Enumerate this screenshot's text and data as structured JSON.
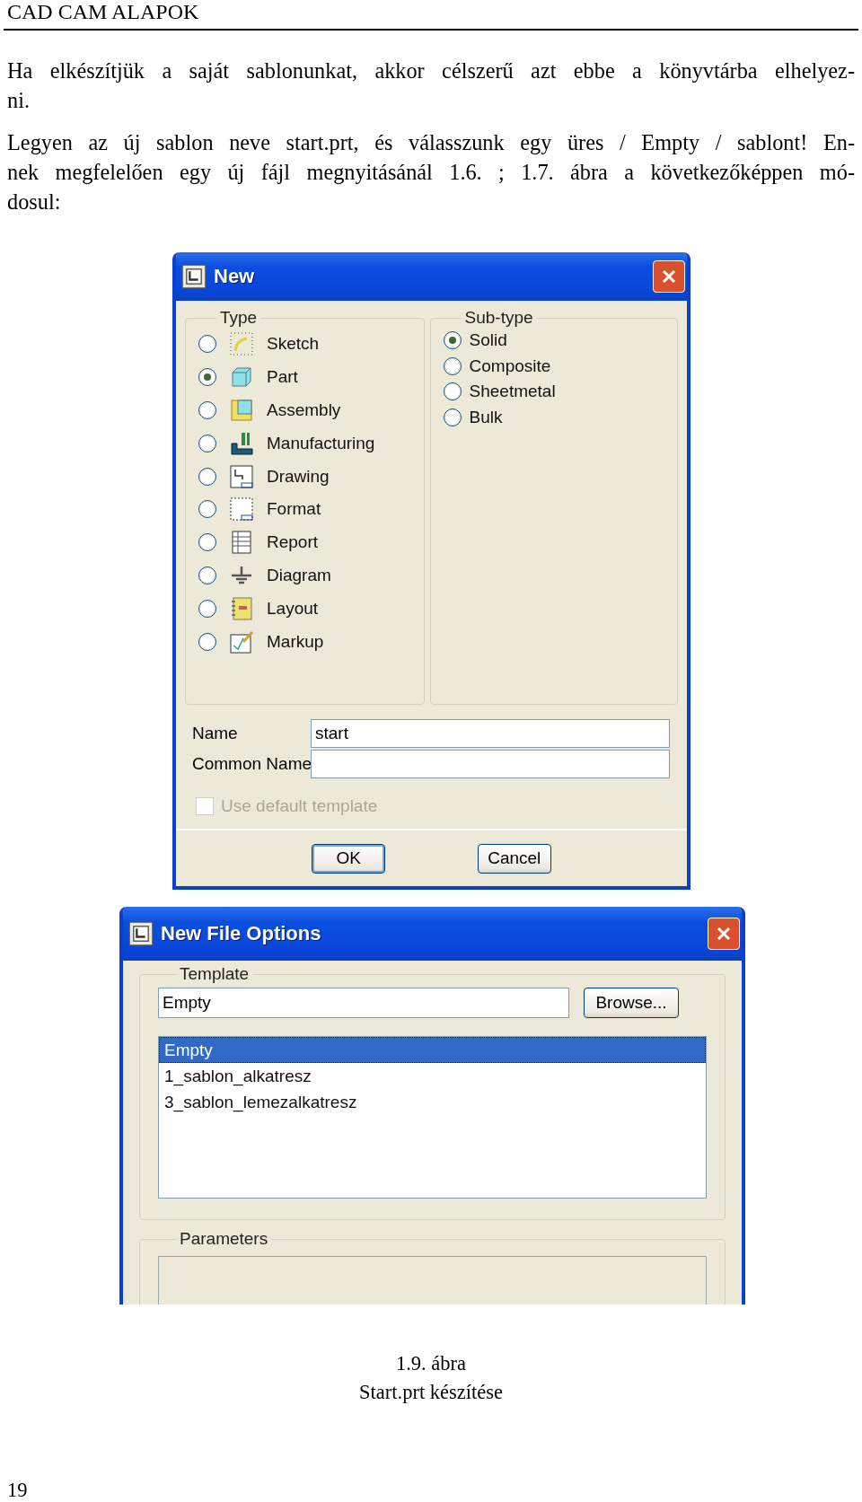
{
  "header": {
    "title": "CAD CAM ALAPOK"
  },
  "paragraphs": [
    {
      "lines": [
        "Ha elkészítjük a saját sablonunkat, akkor célszerű azt ebbe a könyvtárba elhelyez-",
        "ni."
      ]
    },
    {
      "lines": [
        "Legyen az új sablon neve start.prt, és válasszunk egy üres / Empty / sablont! En-",
        "nek megfelelően egy új fájl megnyitásánál 1.6. ; 1.7. ábra a következőképpen mó-",
        "dosul:"
      ]
    }
  ],
  "new_dialog": {
    "title": "New",
    "type_group": {
      "label": "Type",
      "items": [
        {
          "label": "Sketch",
          "selected": false
        },
        {
          "label": "Part",
          "selected": true
        },
        {
          "label": "Assembly",
          "selected": false
        },
        {
          "label": "Manufacturing",
          "selected": false
        },
        {
          "label": "Drawing",
          "selected": false
        },
        {
          "label": "Format",
          "selected": false
        },
        {
          "label": "Report",
          "selected": false
        },
        {
          "label": "Diagram",
          "selected": false
        },
        {
          "label": "Layout",
          "selected": false
        },
        {
          "label": "Markup",
          "selected": false
        }
      ]
    },
    "subtype_group": {
      "label": "Sub-type",
      "items": [
        {
          "label": "Solid",
          "selected": true
        },
        {
          "label": "Composite",
          "selected": false
        },
        {
          "label": "Sheetmetal",
          "selected": false
        },
        {
          "label": "Bulk",
          "selected": false
        }
      ]
    },
    "fields": [
      {
        "label": "Name",
        "value": "start"
      },
      {
        "label": "Common Name"
      }
    ],
    "checkbox": {
      "label": "Use default template",
      "checked": false,
      "disabled": true
    },
    "buttons": [
      "OK",
      "Cancel"
    ]
  },
  "options_dialog": {
    "title": "New File Options",
    "template_label": "Template",
    "template_value": "Empty",
    "browse_button": "Browse...",
    "templates": [
      {
        "label": "Empty",
        "selected": true
      },
      {
        "label": "1_sablon_alkatresz",
        "selected": false
      },
      {
        "label": "3_sablon_lemezalkatresz",
        "selected": false
      }
    ],
    "parameters_label": "Parameters"
  },
  "caption": {
    "number": "1.9. ábra",
    "title": "Start.prt készítése"
  },
  "page_number": "19"
}
